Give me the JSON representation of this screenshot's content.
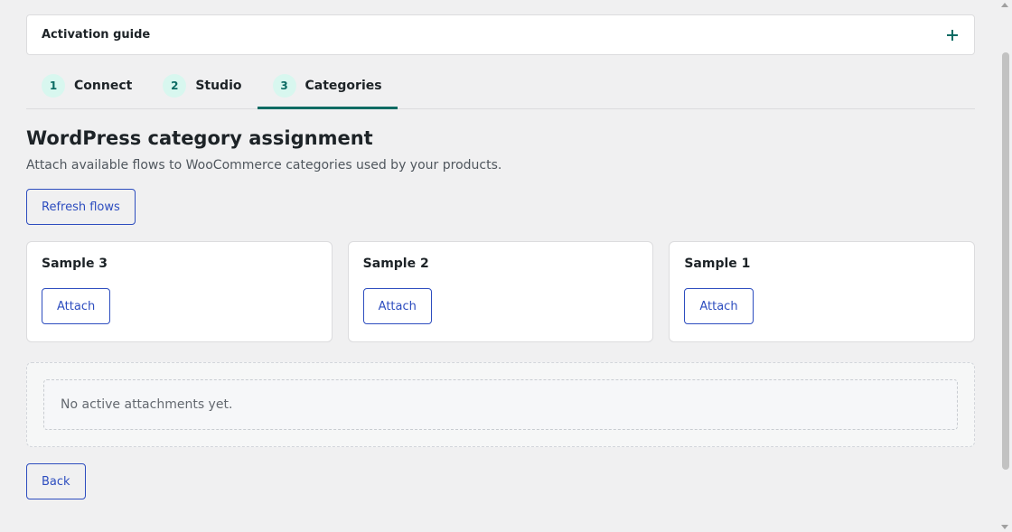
{
  "accordion": {
    "title": "Activation guide",
    "toggle_icon": "plus-icon"
  },
  "tabs": [
    {
      "number": "1",
      "label": "Connect",
      "active": false
    },
    {
      "number": "2",
      "label": "Studio",
      "active": false
    },
    {
      "number": "3",
      "label": "Categories",
      "active": true
    }
  ],
  "main": {
    "heading": "WordPress category assignment",
    "description": "Attach available flows to WooCommerce categories used by your products.",
    "refresh_label": "Refresh flows",
    "flows": [
      {
        "name": "Sample 3",
        "button": "Attach"
      },
      {
        "name": "Sample 2",
        "button": "Attach"
      },
      {
        "name": "Sample 1",
        "button": "Attach"
      }
    ],
    "empty_message": "No active attachments yet.",
    "back_label": "Back"
  },
  "colors": {
    "accent": "#0b6b63",
    "link": "#2d4dbf",
    "background": "#f0f0f1"
  }
}
